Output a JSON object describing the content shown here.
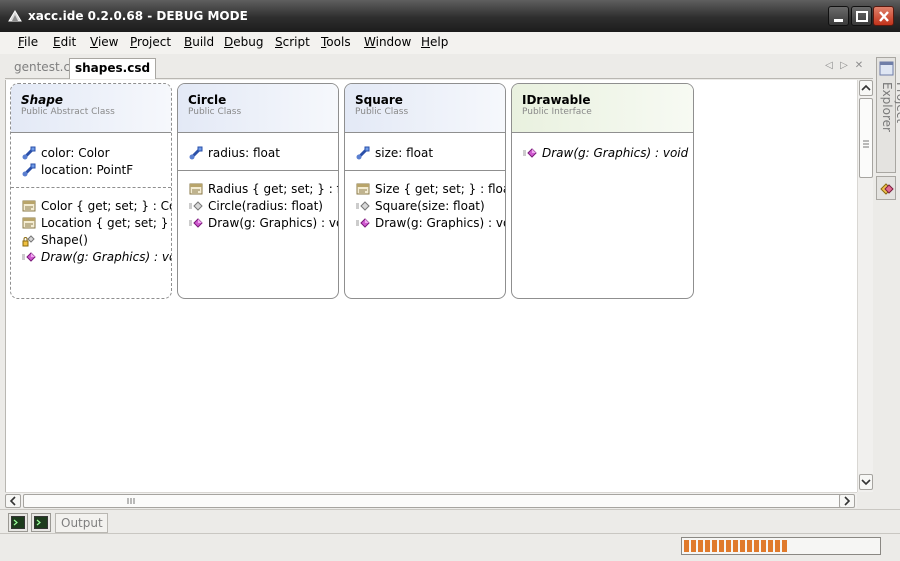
{
  "window": {
    "title": "xacc.ide 0.2.0.68 - DEBUG MODE"
  },
  "menu": [
    {
      "label": "File",
      "underline": "F",
      "rest": "ile"
    },
    {
      "label": "Edit",
      "underline": "E",
      "rest": "dit"
    },
    {
      "label": "View",
      "underline": "V",
      "rest": "iew"
    },
    {
      "label": "Project",
      "underline": "P",
      "rest": "roject"
    },
    {
      "label": "Build",
      "underline": "B",
      "rest": "uild"
    },
    {
      "label": "Debug",
      "underline": "D",
      "rest": "ebug"
    },
    {
      "label": "Script",
      "underline": "S",
      "rest": "cript"
    },
    {
      "label": "Tools",
      "underline": "T",
      "rest": "ools"
    },
    {
      "label": "Window",
      "underline": "W",
      "rest": "indow"
    },
    {
      "label": "Help",
      "underline": "H",
      "rest": "elp"
    }
  ],
  "tabs": {
    "inactive": "gentest.cs",
    "active": "shapes.csd"
  },
  "side_panel": {
    "project_explorer": "Project Explorer"
  },
  "bottom": {
    "output_label": "Output"
  },
  "status": {
    "progress_percent": 55
  },
  "classes": {
    "shape": {
      "name": "Shape",
      "kind": "Public Abstract Class",
      "fields": [
        {
          "text": "color: Color",
          "icon": "field-icon"
        },
        {
          "text": "location: PointF",
          "icon": "field-icon"
        }
      ],
      "members": [
        {
          "text": "Color { get; set; } : Color",
          "icon": "property-icon"
        },
        {
          "text": "Location { get; set; } : PointF",
          "icon": "property-icon"
        },
        {
          "text": "Shape()",
          "icon": "protected-constructor-icon"
        },
        {
          "text": "Draw(g: Graphics) : void",
          "icon": "abstract-method-icon",
          "italic": true
        }
      ]
    },
    "circle": {
      "name": "Circle",
      "kind": "Public Class",
      "fields": [
        {
          "text": "radius: float",
          "icon": "field-icon"
        }
      ],
      "members": [
        {
          "text": "Radius { get; set; } : float",
          "icon": "property-icon"
        },
        {
          "text": "Circle(radius: float)",
          "icon": "constructor-icon"
        },
        {
          "text": "Draw(g: Graphics) : void",
          "icon": "method-icon"
        }
      ]
    },
    "square": {
      "name": "Square",
      "kind": "Public Class",
      "fields": [
        {
          "text": "size: float",
          "icon": "field-icon"
        }
      ],
      "members": [
        {
          "text": "Size { get; set; } : float",
          "icon": "property-icon"
        },
        {
          "text": "Square(size: float)",
          "icon": "constructor-icon"
        },
        {
          "text": "Draw(g: Graphics) : void",
          "icon": "method-icon"
        }
      ]
    },
    "idrawable": {
      "name": "IDrawable",
      "kind": "Public Interface",
      "members": [
        {
          "text": "Draw(g: Graphics) : void",
          "icon": "interface-method-icon",
          "italic": true
        }
      ]
    }
  },
  "colors": {
    "accent_progress": "#e07a2b",
    "class_header": "#e3e9f6",
    "interface_header": "#e9f1df",
    "close_button": "#c2331b"
  }
}
